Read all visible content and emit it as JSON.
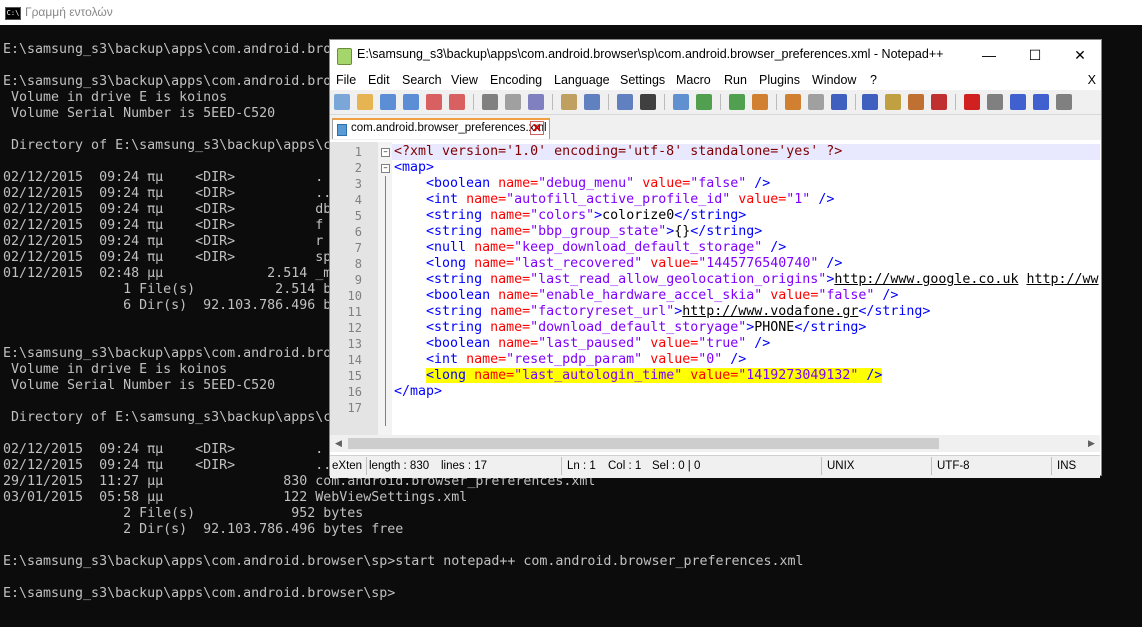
{
  "cmd": {
    "title": "Γραμμή εντολών",
    "icon": "C:\\",
    "lines": [
      "E:\\samsung_s3\\backup\\apps\\com.android.bro",
      "",
      "E:\\samsung_s3\\backup\\apps\\com.android.bro",
      " Volume in drive E is koinos",
      " Volume Serial Number is 5EED-C520",
      "",
      " Directory of E:\\samsung_s3\\backup\\apps\\c",
      "",
      "02/12/2015  09:24 πμ    <DIR>          .",
      "02/12/2015  09:24 πμ    <DIR>          ..",
      "02/12/2015  09:24 πμ    <DIR>          db",
      "02/12/2015  09:24 πμ    <DIR>          f",
      "02/12/2015  09:24 πμ    <DIR>          r",
      "02/12/2015  09:24 πμ    <DIR>          sp",
      "01/12/2015  02:48 μμ             2.514 _m",
      "               1 File(s)          2.514 b",
      "               6 Dir(s)  92.103.786.496 b",
      "",
      "",
      "E:\\samsung_s3\\backup\\apps\\com.android.bro",
      " Volume in drive E is koinos",
      " Volume Serial Number is 5EED-C520",
      "",
      " Directory of E:\\samsung_s3\\backup\\apps\\c",
      "",
      "02/12/2015  09:24 πμ    <DIR>          .",
      "02/12/2015  09:24 πμ    <DIR>          ..",
      "29/11/2015  11:27 μμ               830 com.android.browser_preferences.xml",
      "03/01/2015  05:58 μμ               122 WebViewSettings.xml",
      "               2 File(s)            952 bytes",
      "               2 Dir(s)  92.103.786.496 bytes free",
      "",
      "E:\\samsung_s3\\backup\\apps\\com.android.browser\\sp>start notepad++ com.android.browser_preferences.xml",
      "",
      "E:\\samsung_s3\\backup\\apps\\com.android.browser\\sp>"
    ]
  },
  "npp": {
    "title": "E:\\samsung_s3\\backup\\apps\\com.android.browser\\sp\\com.android.browser_preferences.xml - Notepad++",
    "window_buttons": {
      "minimize": "—",
      "maximize": "☐",
      "close": "✕"
    },
    "menu": [
      "File",
      "Edit",
      "Search",
      "View",
      "Encoding",
      "Language",
      "Settings",
      "Macro",
      "Run",
      "Plugins",
      "Window",
      "?"
    ],
    "menu_close": "X",
    "tab": {
      "label": "com.android.browser_preferences.xml",
      "close": "✕"
    },
    "toolbar_icons": [
      "new-file-icon",
      "open-file-icon",
      "save-icon",
      "save-all-icon",
      "close-icon",
      "close-all-icon",
      "print-icon",
      "cut-icon",
      "copy-icon",
      "paste-icon",
      "undo-icon",
      "redo-icon",
      "find-icon",
      "replace-icon",
      "zoom-in-icon",
      "zoom-out-icon",
      "sync-vertical-icon",
      "sync-horizontal-icon",
      "word-wrap-icon",
      "show-all-chars-icon",
      "indent-guide-icon",
      "udl-icon",
      "doc-map-icon",
      "function-list-icon",
      "record-macro-icon",
      "stop-macro-icon",
      "play-macro-icon",
      "run-macro-icon",
      "save-macro-icon"
    ],
    "editor": {
      "line_numbers": [
        "1",
        "2",
        "3",
        "4",
        "5",
        "6",
        "7",
        "8",
        "9",
        "10",
        "11",
        "12",
        "13",
        "14",
        "15",
        "16",
        "17"
      ],
      "lines": [
        [
          {
            "c": "pi",
            "t": "<?xml version='1.0' encoding='utf-8' standalone='yes' ?>"
          }
        ],
        [
          {
            "c": "tag",
            "t": "<map>"
          }
        ],
        [
          {
            "c": "txt",
            "t": "    "
          },
          {
            "c": "tag",
            "t": "<boolean "
          },
          {
            "c": "attr",
            "t": "name="
          },
          {
            "c": "val",
            "t": "\"debug_menu\""
          },
          {
            "c": "attr",
            "t": " value="
          },
          {
            "c": "val",
            "t": "\"false\""
          },
          {
            "c": "tag",
            "t": " />"
          }
        ],
        [
          {
            "c": "txt",
            "t": "    "
          },
          {
            "c": "tag",
            "t": "<int "
          },
          {
            "c": "attr",
            "t": "name="
          },
          {
            "c": "val",
            "t": "\"autofill_active_profile_id\""
          },
          {
            "c": "attr",
            "t": " value="
          },
          {
            "c": "val",
            "t": "\"1\""
          },
          {
            "c": "tag",
            "t": " />"
          }
        ],
        [
          {
            "c": "txt",
            "t": "    "
          },
          {
            "c": "tag",
            "t": "<string "
          },
          {
            "c": "attr",
            "t": "name="
          },
          {
            "c": "val",
            "t": "\"colors\""
          },
          {
            "c": "tag",
            "t": ">"
          },
          {
            "c": "txt",
            "t": "colorize0"
          },
          {
            "c": "tag",
            "t": "</string>"
          }
        ],
        [
          {
            "c": "txt",
            "t": "    "
          },
          {
            "c": "tag",
            "t": "<string "
          },
          {
            "c": "attr",
            "t": "name="
          },
          {
            "c": "val",
            "t": "\"bbp_group_state\""
          },
          {
            "c": "tag",
            "t": ">"
          },
          {
            "c": "txt",
            "t": "{}"
          },
          {
            "c": "tag",
            "t": "</string>"
          }
        ],
        [
          {
            "c": "txt",
            "t": "    "
          },
          {
            "c": "tag",
            "t": "<null "
          },
          {
            "c": "attr",
            "t": "name="
          },
          {
            "c": "val",
            "t": "\"keep_download_default_storage\""
          },
          {
            "c": "tag",
            "t": " />"
          }
        ],
        [
          {
            "c": "txt",
            "t": "    "
          },
          {
            "c": "tag",
            "t": "<long "
          },
          {
            "c": "attr",
            "t": "name="
          },
          {
            "c": "val",
            "t": "\"last_recovered\""
          },
          {
            "c": "attr",
            "t": " value="
          },
          {
            "c": "val",
            "t": "\"1445776540740\""
          },
          {
            "c": "tag",
            "t": " />"
          }
        ],
        [
          {
            "c": "txt",
            "t": "    "
          },
          {
            "c": "tag",
            "t": "<string "
          },
          {
            "c": "attr",
            "t": "name="
          },
          {
            "c": "val",
            "t": "\"last_read_allow_geolocation_origins\""
          },
          {
            "c": "tag",
            "t": ">"
          },
          {
            "c": "url",
            "t": "http://www.google.co.uk"
          },
          {
            "c": "txt",
            "t": " "
          },
          {
            "c": "url",
            "t": "http://ww"
          }
        ],
        [
          {
            "c": "txt",
            "t": "    "
          },
          {
            "c": "tag",
            "t": "<boolean "
          },
          {
            "c": "attr",
            "t": "name="
          },
          {
            "c": "val",
            "t": "\"enable_hardware_accel_skia\""
          },
          {
            "c": "attr",
            "t": " value="
          },
          {
            "c": "val",
            "t": "\"false\""
          },
          {
            "c": "tag",
            "t": " />"
          }
        ],
        [
          {
            "c": "txt",
            "t": "    "
          },
          {
            "c": "tag",
            "t": "<string "
          },
          {
            "c": "attr",
            "t": "name="
          },
          {
            "c": "val",
            "t": "\"factoryreset_url\""
          },
          {
            "c": "tag",
            "t": ">"
          },
          {
            "c": "url",
            "t": "http://www.vodafone.gr"
          },
          {
            "c": "tag",
            "t": "</string>"
          }
        ],
        [
          {
            "c": "txt",
            "t": "    "
          },
          {
            "c": "tag",
            "t": "<string "
          },
          {
            "c": "attr",
            "t": "name="
          },
          {
            "c": "val",
            "t": "\"download_default_storyage\""
          },
          {
            "c": "tag",
            "t": ">"
          },
          {
            "c": "txt",
            "t": "PHONE"
          },
          {
            "c": "tag",
            "t": "</string>"
          }
        ],
        [
          {
            "c": "txt",
            "t": "    "
          },
          {
            "c": "tag",
            "t": "<boolean "
          },
          {
            "c": "attr",
            "t": "name="
          },
          {
            "c": "val",
            "t": "\"last_paused\""
          },
          {
            "c": "attr",
            "t": " value="
          },
          {
            "c": "val",
            "t": "\"true\""
          },
          {
            "c": "tag",
            "t": " />"
          }
        ],
        [
          {
            "c": "txt",
            "t": "    "
          },
          {
            "c": "tag",
            "t": "<int "
          },
          {
            "c": "attr",
            "t": "name="
          },
          {
            "c": "val",
            "t": "\"reset_pdp_param\""
          },
          {
            "c": "attr",
            "t": " value="
          },
          {
            "c": "val",
            "t": "\"0\""
          },
          {
            "c": "tag",
            "t": " />"
          }
        ],
        [
          {
            "c": "txt",
            "t": "    "
          },
          {
            "c": "tag",
            "t": "<long "
          },
          {
            "c": "attr",
            "t": "name="
          },
          {
            "c": "val",
            "t": "\"last_autologin_time\""
          },
          {
            "c": "attr",
            "t": " value="
          },
          {
            "c": "val",
            "t": "\"1419273049132\""
          },
          {
            "c": "tag",
            "t": " />"
          }
        ],
        [
          {
            "c": "tag",
            "t": "</map>"
          }
        ],
        []
      ]
    },
    "status": {
      "lang": "eXten",
      "length": "length : 830",
      "lines": "lines : 17",
      "ln": "Ln : 1",
      "col": "Col : 1",
      "sel": "Sel : 0 | 0",
      "eol": "UNIX",
      "encoding": "UTF-8",
      "mode": "INS"
    }
  },
  "colors": {
    "highlight": "#ffff00",
    "current_line": "#e8e8ff",
    "tab_accent": "#f0a040"
  }
}
